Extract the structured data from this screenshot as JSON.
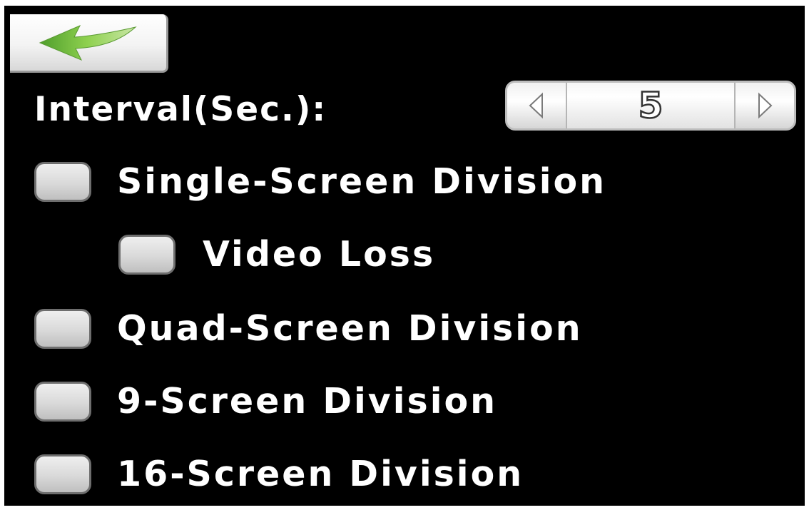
{
  "back_button": {
    "icon": "back-arrow-icon",
    "icon_color": "#7dc242"
  },
  "interval": {
    "label": "Interval(Sec.):",
    "value": "5",
    "decrement_icon": "triangle-left-icon",
    "increment_icon": "triangle-right-icon"
  },
  "options": {
    "single": {
      "label": "Single-Screen Division",
      "checked": false
    },
    "video_loss": {
      "label": "Video Loss",
      "checked": false
    },
    "quad": {
      "label": "Quad-Screen Division",
      "checked": false
    },
    "nine": {
      "label": "9-Screen Division",
      "checked": false
    },
    "sixteen": {
      "label": "16-Screen Division",
      "checked": false
    }
  },
  "colors": {
    "background": "#000000",
    "text": "#ffffff",
    "accent_arrow": "#7dc242"
  }
}
